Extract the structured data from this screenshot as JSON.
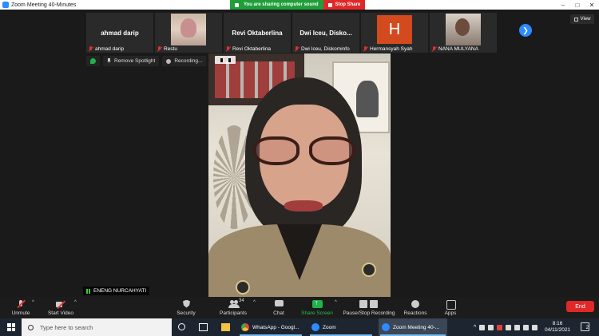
{
  "window": {
    "title": "Zoom Meeting 40-Minutes"
  },
  "share_banner": {
    "status": "You are sharing computer sound",
    "stop_label": "Stop Share"
  },
  "view_button": {
    "label": "View"
  },
  "thumbnails": [
    {
      "big_name": "ahmad darip",
      "caption": "ahmad darip",
      "type": "name"
    },
    {
      "big_name": "",
      "caption": "Restu",
      "type": "photo"
    },
    {
      "big_name": "Revi Oktaberlina",
      "caption": "Revi Oktaberlina",
      "type": "name"
    },
    {
      "big_name": "Dwi Iceu, Disko...",
      "caption": "Dwi Iceu, Diskominfo",
      "type": "name"
    },
    {
      "big_name": "H",
      "caption": "Hermansyah Syah",
      "type": "letter"
    },
    {
      "big_name": "",
      "caption": "NANA MULYANA",
      "type": "photo"
    }
  ],
  "pills": {
    "spotlight": "Remove Spotlight",
    "recording": "Recording..."
  },
  "speaker": {
    "name": "ENENG NURCAHYATI"
  },
  "toolbar": {
    "unmute": "Unmute",
    "start_video": "Start Video",
    "security": "Security",
    "participants": "Participants",
    "participants_count": "34",
    "chat": "Chat",
    "share_screen": "Share Screen",
    "pause_recording": "Pause/Stop Recording",
    "reactions": "Reactions",
    "apps": "Apps",
    "end": "End"
  },
  "taskbar": {
    "search_placeholder": "Type here to search",
    "apps": [
      {
        "label": "WhatsApp - Googl...",
        "color": "#e8453c"
      },
      {
        "label": "Zoom",
        "color": "#2d8cff"
      },
      {
        "label": "Zoom Meeting 40-...",
        "color": "#2d8cff"
      }
    ],
    "time": "8:16",
    "date": "04/11/2021",
    "notification_count": "2"
  },
  "colors": {
    "accent": "#2d8cff",
    "share_green": "#1f9e3a",
    "danger": "#e02828"
  }
}
